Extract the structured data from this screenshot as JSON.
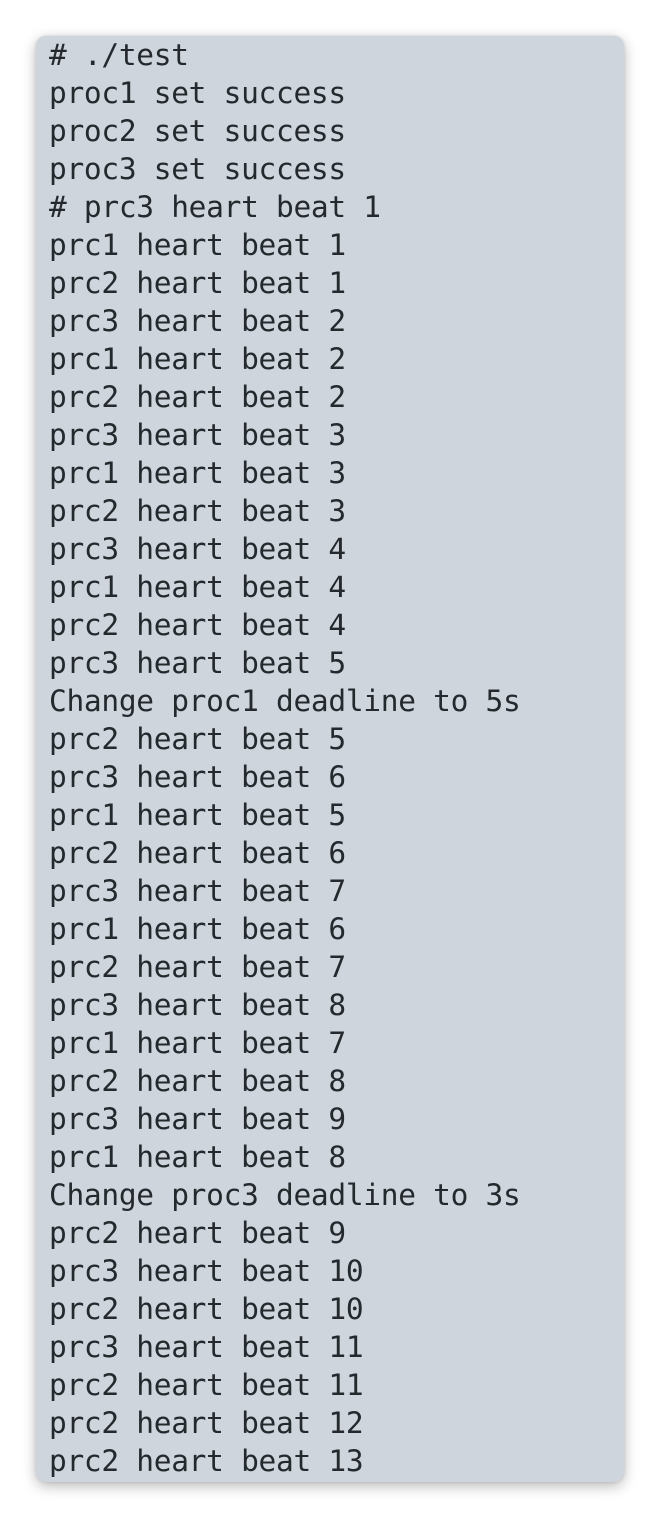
{
  "terminal": {
    "lines": [
      "# ./test",
      "proc1 set success",
      "proc2 set success",
      "proc3 set success",
      "# prc3 heart beat 1",
      "prc1 heart beat 1",
      "prc2 heart beat 1",
      "prc3 heart beat 2",
      "prc1 heart beat 2",
      "prc2 heart beat 2",
      "prc3 heart beat 3",
      "prc1 heart beat 3",
      "prc2 heart beat 3",
      "prc3 heart beat 4",
      "prc1 heart beat 4",
      "prc2 heart beat 4",
      "prc3 heart beat 5",
      "Change proc1 deadline to 5s",
      "prc2 heart beat 5",
      "prc3 heart beat 6",
      "prc1 heart beat 5",
      "prc2 heart beat 6",
      "prc3 heart beat 7",
      "prc1 heart beat 6",
      "prc2 heart beat 7",
      "prc3 heart beat 8",
      "prc1 heart beat 7",
      "prc2 heart beat 8",
      "prc3 heart beat 9",
      "prc1 heart beat 8",
      "Change proc3 deadline to 3s",
      "prc2 heart beat 9",
      "prc3 heart beat 10",
      "prc2 heart beat 10",
      "prc3 heart beat 11",
      "prc2 heart beat 11",
      "prc2 heart beat 12",
      "prc2 heart beat 13"
    ]
  }
}
